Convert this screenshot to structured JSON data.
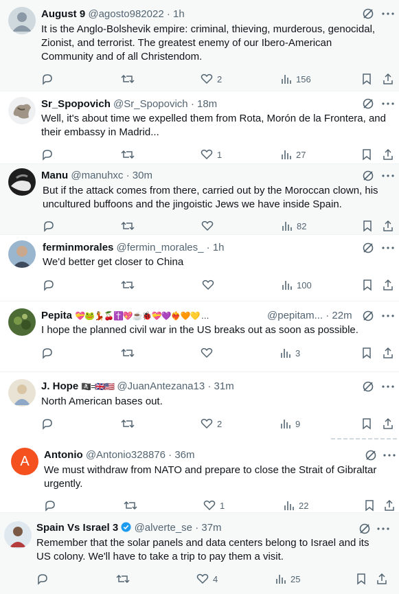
{
  "tweets": [
    {
      "name": "August 9",
      "handle": "@agosto982022",
      "time": "· 1h",
      "text": "It is the Anglo-Bolshevik empire: criminal, thieving, murderous, genocidal,\nZionist, and terrorist. The greatest enemy of our Ibero-American\nCommunity and of all Christendom.",
      "likes": "2",
      "views": "156"
    },
    {
      "name": "Sr_Spopovich",
      "handle": "@Sr_Spopovich",
      "time": "· 18m",
      "text": "Well, it's about time we expelled them from Rota, Morón de la Frontera, and\ntheir embassy in Madrid...",
      "likes": "1",
      "views": "27"
    },
    {
      "name": "Manu",
      "handle": "@manuhxc",
      "time": "· 30m",
      "text": "But if the attack comes from there, carried out by the Moroccan clown, his\nuncultured buffoons and the jingoistic Jews we have inside Spain.",
      "likes": "",
      "views": "82"
    },
    {
      "name": "ferminmorales",
      "handle": "@fermin_morales_",
      "time": "· 1h",
      "text": "We'd better get closer to China",
      "likes": "",
      "views": "100"
    },
    {
      "name": "Pepita",
      "emoji": "💝🐸💃🍒✝️💖☕🐞💝💜❤️‍🔥🧡💛 …",
      "handle": "@pepitam...",
      "time": "· 22m",
      "text": "I hope the planned civil war in the US breaks out as soon as possible.",
      "likes": "",
      "views": "3"
    },
    {
      "name": "J. Hope",
      "emoji": "🏴‍☠️=🇬🇧🇺🇸",
      "handle": "@JuanAntezana13",
      "time": "· 31m",
      "text": "North American bases out.",
      "likes": "2",
      "views": "9"
    },
    {
      "name": "Antonio",
      "handle": "@Antonio328876",
      "time": "· 36m",
      "avatar_letter": "A",
      "text": "We must withdraw from NATO and prepare to close the Strait of Gibraltar\nurgently.",
      "likes": "1",
      "views": "22"
    },
    {
      "name": "Spain Vs Israel 3",
      "handle": "@alverte_se",
      "time": "· 37m",
      "text": "Remember that the solar panels and data centers belong to Israel and its\nUS colony. We'll have to take a trip to pay them a visit.",
      "likes": "4",
      "views": "25"
    }
  ],
  "colors": {
    "text": "#0f1419",
    "muted": "#536471",
    "verified": "#1d9bf0",
    "avatar_orange": "#f4511e"
  }
}
